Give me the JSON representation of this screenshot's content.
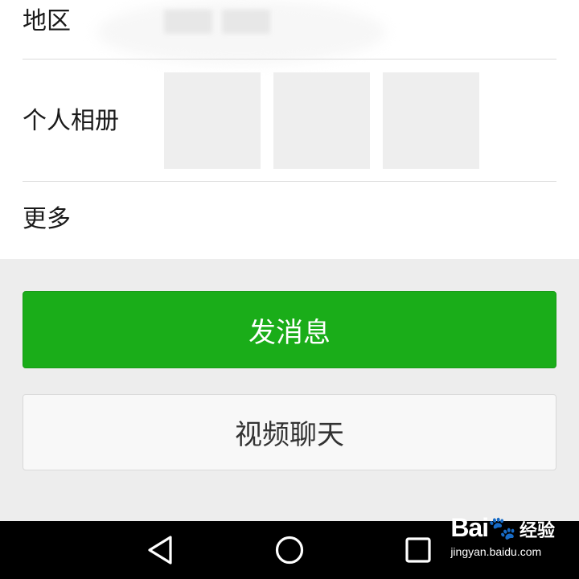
{
  "profile": {
    "region_label": "地区",
    "album_label": "个人相册",
    "more_label": "更多"
  },
  "actions": {
    "send_message_label": "发消息",
    "video_chat_label": "视频聊天"
  },
  "colors": {
    "primary_green": "#1aad19",
    "background": "#ededed",
    "navbar": "#000000"
  },
  "navbar": {
    "icons": [
      "back-triangle-icon",
      "home-circle-icon",
      "recents-square-icon"
    ]
  },
  "watermark": {
    "brand": "Bai",
    "brand_suffix": "经验",
    "url": "jingyan.baidu.com"
  }
}
